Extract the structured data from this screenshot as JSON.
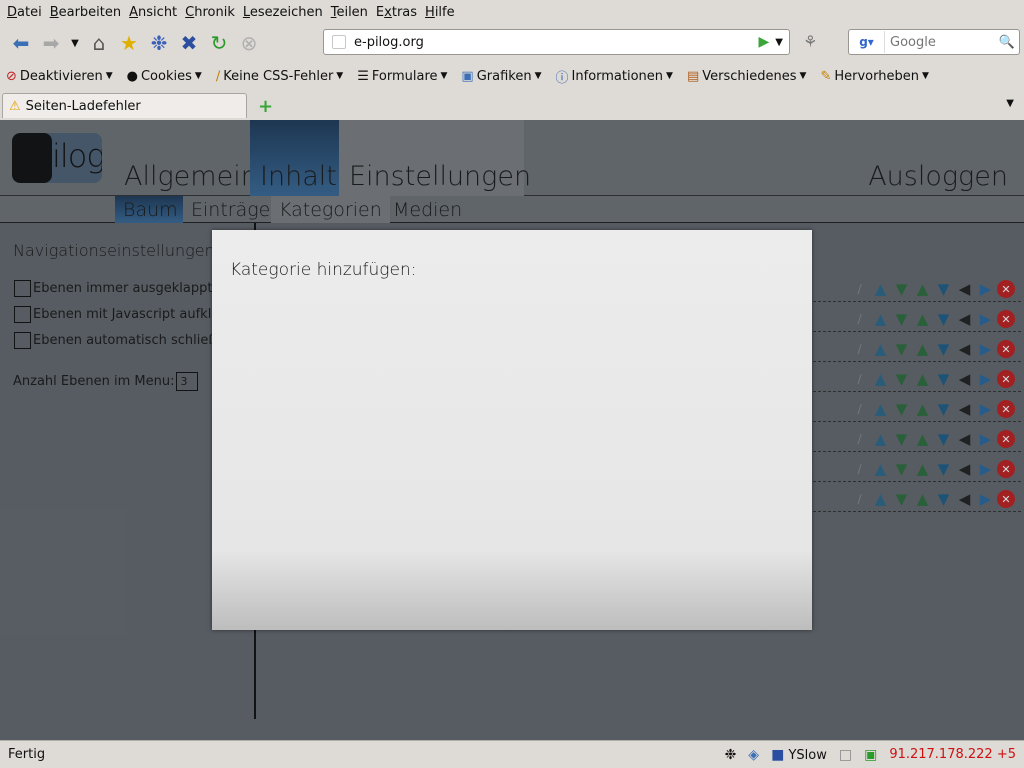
{
  "menubar": {
    "items": [
      {
        "label": "Datei",
        "key": "D",
        "rest": "atei"
      },
      {
        "label": "Bearbeiten",
        "key": "B",
        "rest": "earbeiten"
      },
      {
        "label": "Ansicht",
        "key": "A",
        "rest": "nsicht"
      },
      {
        "label": "Chronik",
        "key": "C",
        "rest": "hronik"
      },
      {
        "label": "Lesezeichen",
        "key": "L",
        "rest": "esezeichen"
      },
      {
        "label": "Teilen",
        "key": "T",
        "rest": "eilen"
      },
      {
        "label": "Extras",
        "pre": "E",
        "key": "x",
        "rest": "tras"
      },
      {
        "label": "Hilfe",
        "key": "H",
        "rest": "ilfe"
      }
    ]
  },
  "navbar": {
    "url": "e-pilog.org",
    "search_placeholder": "Google"
  },
  "devbar": {
    "items": [
      "Deaktivieren",
      "Cookies",
      "Keine CSS-Fehler",
      "Formulare",
      "Grafiken",
      "Informationen",
      "Verschiedenes",
      "Hervorheben"
    ]
  },
  "tabs": {
    "active_title": "Seiten-Ladefehler"
  },
  "site": {
    "logo_text": "epilog",
    "main_tabs": {
      "allgemein": "Allgemein",
      "inhalt": "Inhalt",
      "einstellungen": "Einstellungen"
    },
    "logout": "Ausloggen",
    "sub_tabs": {
      "baum": "Baum",
      "eintraege": "Einträge",
      "kategorien": "Kategorien",
      "medien": "Medien"
    },
    "nav_settings": {
      "title": "Navigationseinstellungen:",
      "opt1": "Ebenen immer ausgeklappt",
      "opt2": "Ebenen mit Javascript aufklappen",
      "opt3": "Ebenen automatisch schließen",
      "levels_label": "Anzahl Ebenen im Menu:",
      "levels_value": "3"
    }
  },
  "modal": {
    "title": "Kategorie hinzufügen:"
  },
  "statusbar": {
    "text": "Fertig",
    "yslow": "YSlow",
    "ip": "91.217.178.222 +5"
  },
  "colors": {
    "accent": "#3a6a98",
    "delete": "#c02020",
    "ip": "#d01010"
  }
}
